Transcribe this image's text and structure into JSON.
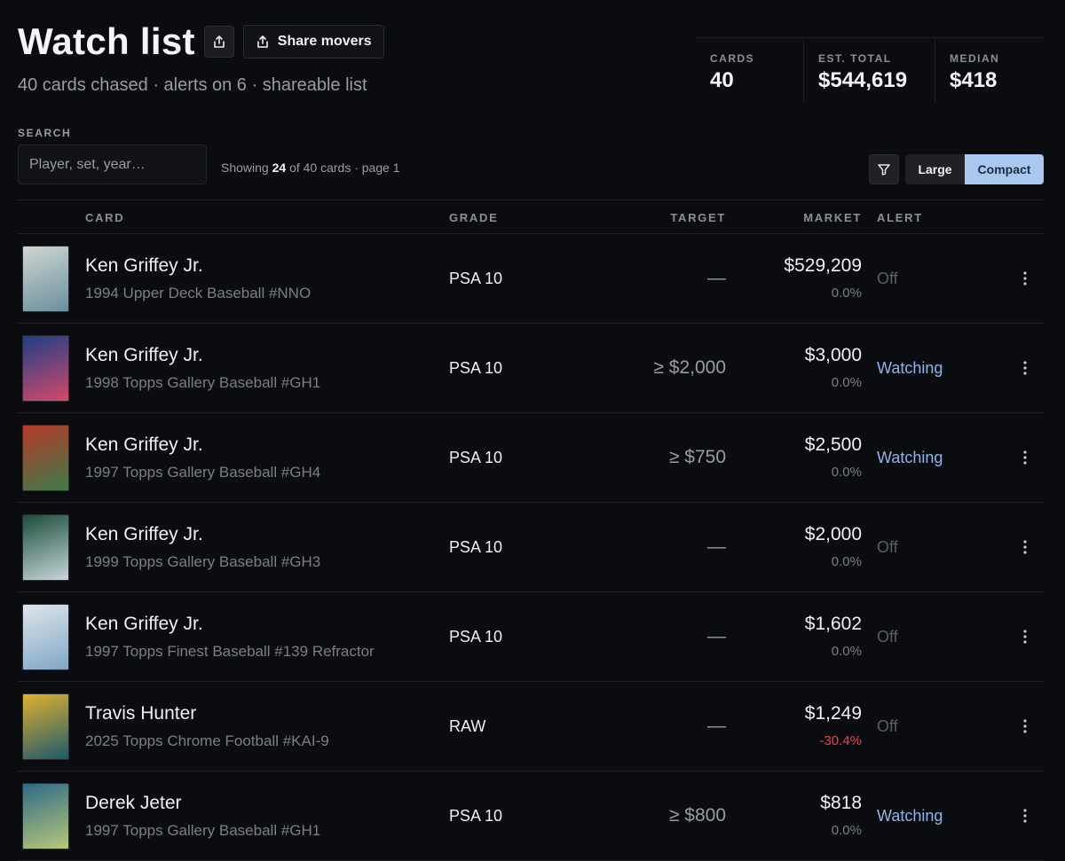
{
  "header": {
    "title": "Watch list",
    "share_label": "Share movers",
    "subtitle": "40 cards chased · alerts on 6 · shareable list"
  },
  "stats": [
    {
      "label": "CARDS",
      "value": "40"
    },
    {
      "label": "EST. TOTAL",
      "value": "$544,619"
    },
    {
      "label": "MEDIAN",
      "value": "$418"
    }
  ],
  "search": {
    "label": "SEARCH",
    "placeholder": "Player, set, year…"
  },
  "showing": {
    "prefix": "Showing",
    "count": "24",
    "suffix": "of 40 cards · page 1"
  },
  "view_toggle": {
    "large": "Large",
    "compact": "Compact",
    "selected": "Compact"
  },
  "columns": {
    "card": "CARD",
    "grade": "GRADE",
    "target": "TARGET",
    "market": "MARKET",
    "alert": "ALERT"
  },
  "rows": [
    {
      "name": "Ken Griffey Jr.",
      "set": "1994 Upper Deck Baseball #NNO",
      "grade": "PSA 10",
      "target": "—",
      "market": "$529,209",
      "change": "0.0%",
      "alert": "Off",
      "thumb_colors": [
        "#cfd6d0",
        "#6b8f9e"
      ]
    },
    {
      "name": "Ken Griffey Jr.",
      "set": "1998 Topps Gallery Baseball #GH1",
      "grade": "PSA 10",
      "target": "≥ $2,000",
      "market": "$3,000",
      "change": "0.0%",
      "alert": "Watching",
      "thumb_colors": [
        "#1e3e86",
        "#d24a6a"
      ]
    },
    {
      "name": "Ken Griffey Jr.",
      "set": "1997 Topps Gallery Baseball #GH4",
      "grade": "PSA 10",
      "target": "≥ $750",
      "market": "$2,500",
      "change": "0.0%",
      "alert": "Watching",
      "thumb_colors": [
        "#b43a2a",
        "#3f7a4a"
      ]
    },
    {
      "name": "Ken Griffey Jr.",
      "set": "1999 Topps Gallery Baseball #GH3",
      "grade": "PSA 10",
      "target": "—",
      "market": "$2,000",
      "change": "0.0%",
      "alert": "Off",
      "thumb_colors": [
        "#1a4d3a",
        "#c8d6da"
      ]
    },
    {
      "name": "Ken Griffey Jr.",
      "set": "1997 Topps Finest Baseball #139 Refractor",
      "grade": "PSA 10",
      "target": "—",
      "market": "$1,602",
      "change": "0.0%",
      "alert": "Off",
      "thumb_colors": [
        "#dfe5ea",
        "#7fa7c8"
      ]
    },
    {
      "name": "Travis Hunter",
      "set": "2025 Topps Chrome Football #KAI-9",
      "grade": "RAW",
      "target": "—",
      "market": "$1,249",
      "change": "-30.4%",
      "alert": "Off",
      "thumb_colors": [
        "#e0b030",
        "#1d5a6a"
      ]
    },
    {
      "name": "Derek Jeter",
      "set": "1997 Topps Gallery Baseball #GH1",
      "grade": "PSA 10",
      "target": "≥ $800",
      "market": "$818",
      "change": "0.0%",
      "alert": "Watching",
      "thumb_colors": [
        "#2f6a86",
        "#b7c77a"
      ]
    }
  ]
}
